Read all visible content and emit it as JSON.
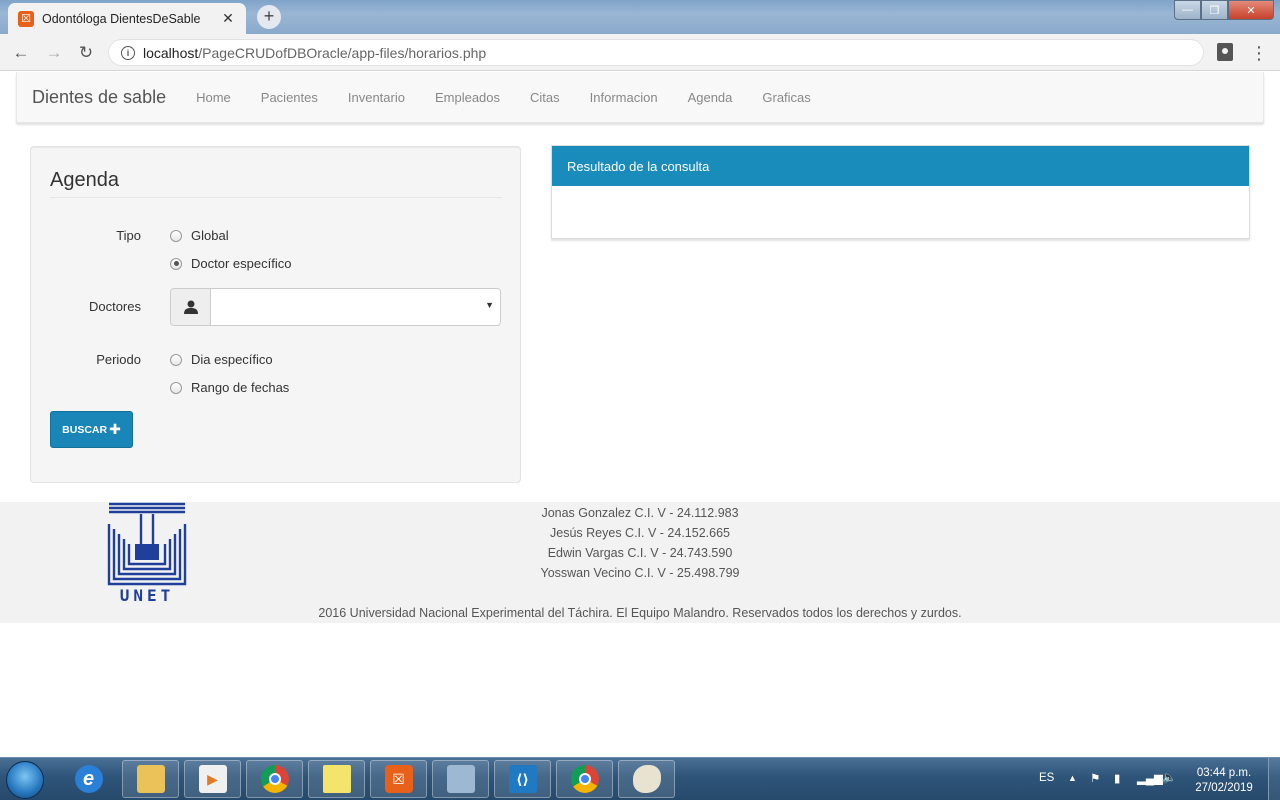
{
  "browser": {
    "tab_title": "Odontóloga DientesDeSable",
    "tab_close": "✕",
    "new_tab": "+",
    "url_host": "localhost",
    "url_path": "/PageCRUDofDBOracle/app-files/horarios.php",
    "window_controls": {
      "minimize": "—",
      "maximize": "❐",
      "close": "✕"
    }
  },
  "navbar": {
    "brand": "Dientes de sable",
    "items": [
      "Home",
      "Pacientes",
      "Inventario",
      "Empleados",
      "Citas",
      "Informacion",
      "Agenda",
      "Graficas"
    ]
  },
  "form": {
    "legend": "Agenda",
    "tipo_label": "Tipo",
    "tipo_options": [
      {
        "label": "Global",
        "checked": false
      },
      {
        "label": "Doctor específico",
        "checked": true
      }
    ],
    "doctores_label": "Doctores",
    "doctores_value": "",
    "periodo_label": "Periodo",
    "periodo_options": [
      {
        "label": "Dia específico",
        "checked": false
      },
      {
        "label": "Rango de fechas",
        "checked": false
      }
    ],
    "buscar_label": "BUSCAR",
    "buscar_icon": "plus-icon"
  },
  "result_panel": {
    "heading": "Resultado de la consulta"
  },
  "footer": {
    "logo_text": "UNET",
    "members": [
      "Jonas Gonzalez C.I. V - 24.112.983",
      "Jesús Reyes C.I. V - 24.152.665",
      "Edwin Vargas C.I. V - 24.743.590",
      "Yosswan Vecino C.I. V - 25.498.799"
    ],
    "copyright": "2016 Universidad Nacional Experimental del Táchira. El Equipo Malandro. Reservados todos los derechos y zurdos."
  },
  "taskbar": {
    "language": "ES",
    "time": "03:44 p.m.",
    "date": "27/02/2019"
  },
  "colors": {
    "primary_button": "#1a86b8",
    "panel_heading": "#1a8cbb",
    "xampp_orange": "#e8611a",
    "logo_blue": "#1f3f9a"
  }
}
